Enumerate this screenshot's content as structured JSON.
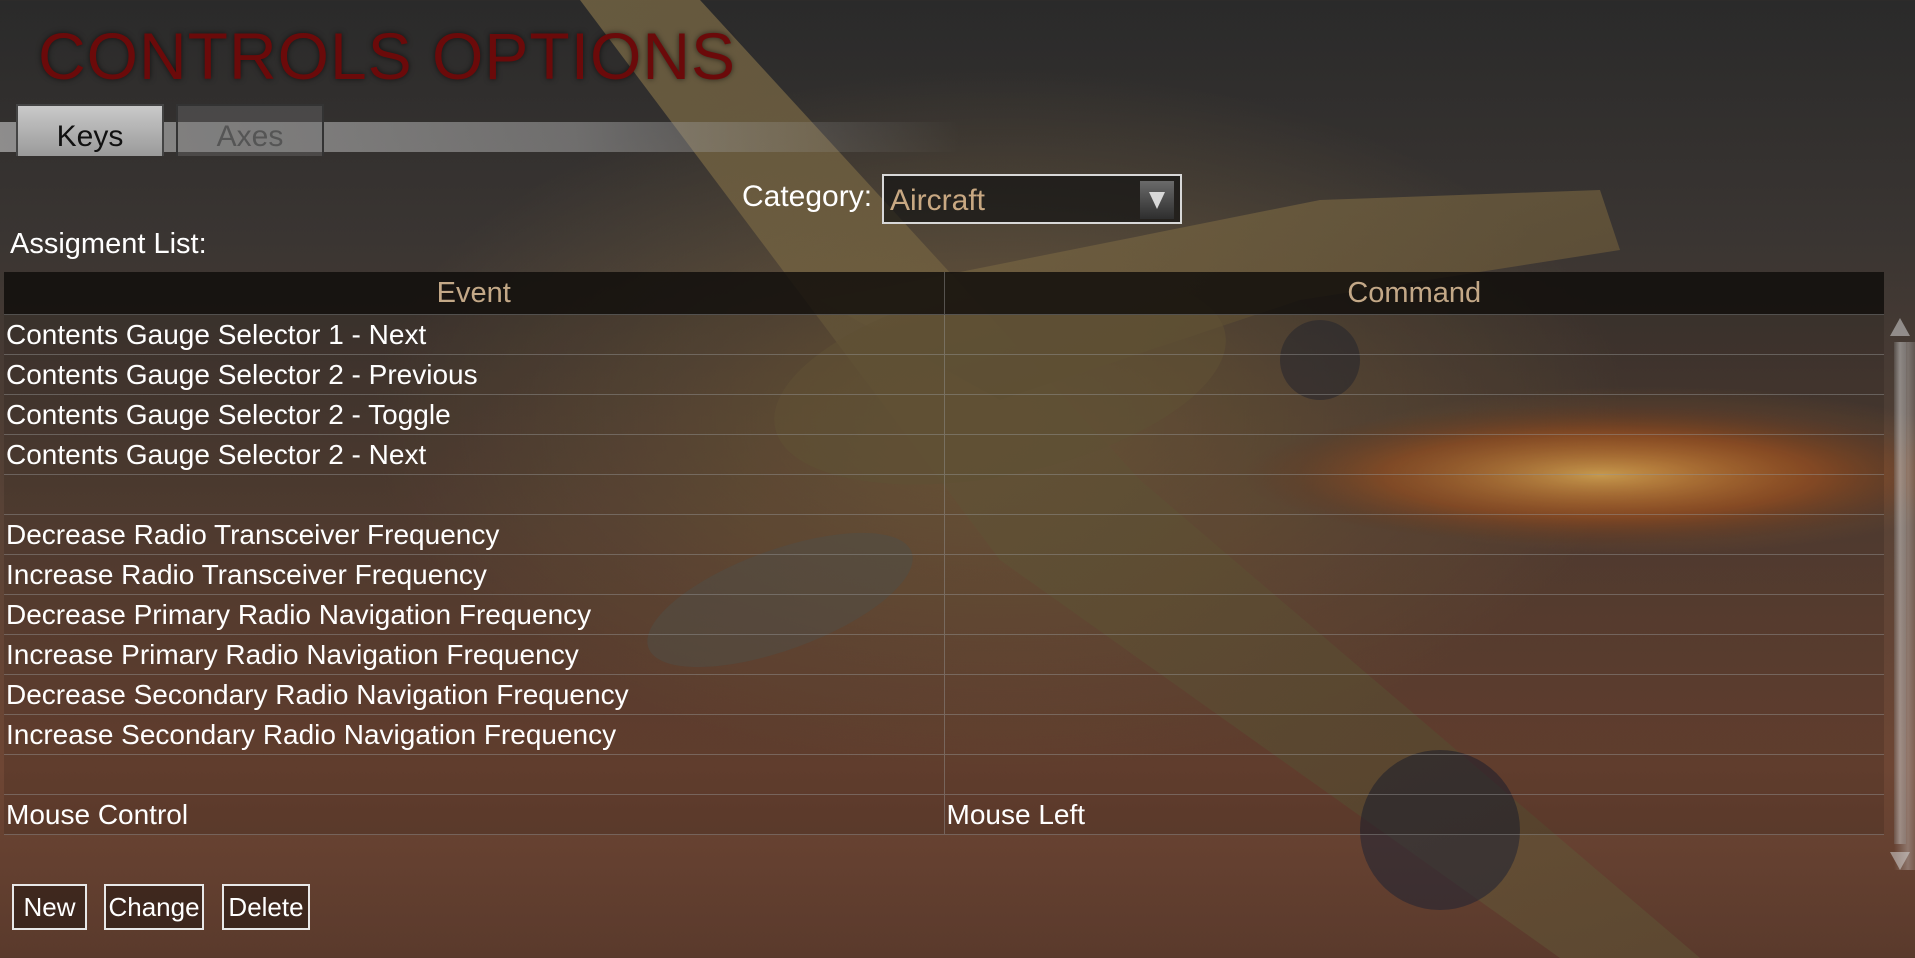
{
  "page": {
    "title": "CONTROLS OPTIONS",
    "title_color": "#6b0a0a"
  },
  "tabs": [
    {
      "label": "Keys",
      "active": true
    },
    {
      "label": "Axes",
      "active": false
    }
  ],
  "category": {
    "label": "Category:",
    "selected": "Aircraft",
    "icon": "chevron-down-icon"
  },
  "assignment": {
    "label": "Assigment List:",
    "columns": [
      "Event",
      "Command"
    ],
    "rows": [
      {
        "event": "Contents Gauge Selector 1 - Next",
        "command": ""
      },
      {
        "event": "Contents Gauge Selector 2 - Previous",
        "command": ""
      },
      {
        "event": "Contents Gauge Selector 2 - Toggle",
        "command": ""
      },
      {
        "event": "Contents Gauge Selector 2 - Next",
        "command": ""
      },
      {
        "event": "",
        "command": ""
      },
      {
        "event": "Decrease Radio Transceiver Frequency",
        "command": ""
      },
      {
        "event": "Increase Radio Transceiver Frequency",
        "command": ""
      },
      {
        "event": "Decrease Primary Radio Navigation Frequency",
        "command": ""
      },
      {
        "event": "Increase Primary Radio Navigation Frequency",
        "command": ""
      },
      {
        "event": "Decrease Secondary Radio Navigation Frequency",
        "command": ""
      },
      {
        "event": "Increase Secondary Radio Navigation Frequency",
        "command": ""
      },
      {
        "event": "",
        "command": ""
      },
      {
        "event": "Mouse Control",
        "command": "Mouse Left"
      }
    ]
  },
  "buttons": {
    "new": "New",
    "change": "Change",
    "delete": "Delete"
  },
  "colors": {
    "header_text": "#c3a887",
    "selected_value": "#c8a882",
    "row_text": "#ffffff"
  }
}
